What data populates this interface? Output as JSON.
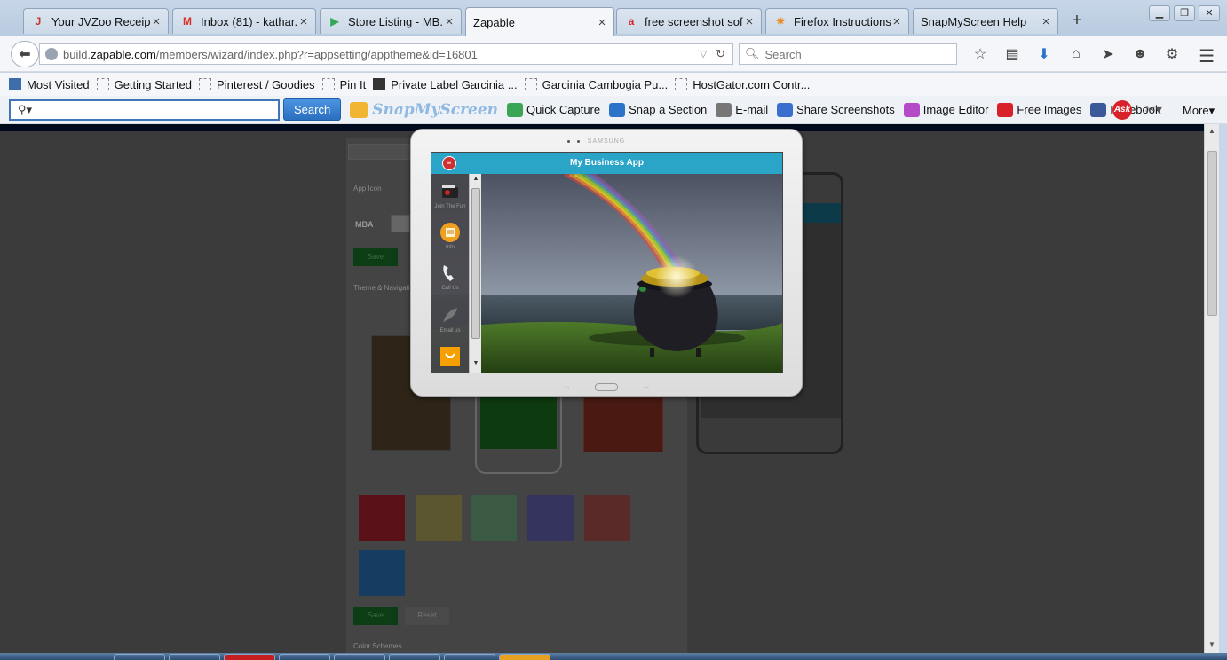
{
  "browser": {
    "tabs": [
      {
        "title": "Your JVZoo Receip...",
        "icon": "jvzoo-icon",
        "icon_color": "#c0392b",
        "glyph": "J"
      },
      {
        "title": "Inbox (81) - kathar...",
        "icon": "gmail-icon",
        "icon_color": "#d93025",
        "glyph": "M"
      },
      {
        "title": "Store Listing - MB...",
        "icon": "google-play-icon",
        "icon_color": "#34a853",
        "glyph": "▶"
      },
      {
        "title": "Zapable",
        "icon": "",
        "icon_color": "",
        "glyph": "",
        "active": true
      },
      {
        "title": "free screenshot sof...",
        "icon": "ask-icon",
        "icon_color": "#d82128",
        "glyph": "a"
      },
      {
        "title": "Firefox Instructions",
        "icon": "firefox-instructions-icon",
        "icon_color": "#f08a24",
        "glyph": "✷"
      },
      {
        "title": "SnapMyScreen Help",
        "icon": "",
        "icon_color": "",
        "glyph": ""
      }
    ],
    "url_domain": "build.zapable.com",
    "url_host_prefix": "build.",
    "url_host_main": "zapable.com",
    "url_path": "/members/wizard/index.php?r=appsetting/apptheme&id=16801",
    "search_placeholder": "Search"
  },
  "bookmarks": [
    {
      "label": "Most Visited"
    },
    {
      "label": "Getting Started"
    },
    {
      "label": "Pinterest / Goodies"
    },
    {
      "label": "Pin It"
    },
    {
      "label": "Private Label Garcinia ..."
    },
    {
      "label": "Garcinia Cambogia Pu..."
    },
    {
      "label": "HostGator.com Contr..."
    }
  ],
  "ask_toolbar": {
    "search_button": "Search",
    "brand": "SnapMyScreen",
    "items": [
      {
        "label": "Quick Capture",
        "color": "#3aa655"
      },
      {
        "label": "Snap a Section",
        "color": "#2a73c8"
      },
      {
        "label": "E-mail",
        "color": "#777777"
      },
      {
        "label": "Share Screenshots",
        "color": "#3b6fcf"
      },
      {
        "label": "Image Editor",
        "color": "#b54ac7"
      },
      {
        "label": "Free Images",
        "color": "#d82128"
      },
      {
        "label": "Facebook",
        "color": "#3b5998"
      }
    ],
    "ask_logo": "Ask",
    "more": "More"
  },
  "page": {
    "left_panel": {
      "app_icon_section": "App Icon",
      "app_initials": "MBA",
      "save_label": "Save",
      "theme_section": "Theme & Navigation",
      "reset_label": "Reset",
      "color_schemes_section": "Color Schemes",
      "theme_tiles": [
        {
          "color": "#5a1218"
        },
        {
          "color": "#5b5630"
        },
        {
          "color": "#3a5a44"
        },
        {
          "color": "#34345e"
        },
        {
          "color": "#5a2a28"
        },
        {
          "color": "#163c62"
        }
      ]
    },
    "tablet": {
      "brand": "SAMSUNG",
      "app_title": "My Business App",
      "sidebar_items": [
        {
          "label": "Join The Fun",
          "icon": "video-icon"
        },
        {
          "label": "Info",
          "icon": "document-icon"
        },
        {
          "label": "Call Us",
          "icon": "phone-icon"
        },
        {
          "label": "Email us",
          "icon": "feather-icon"
        },
        {
          "label": "",
          "icon": "shopping-bag-icon"
        }
      ]
    }
  }
}
